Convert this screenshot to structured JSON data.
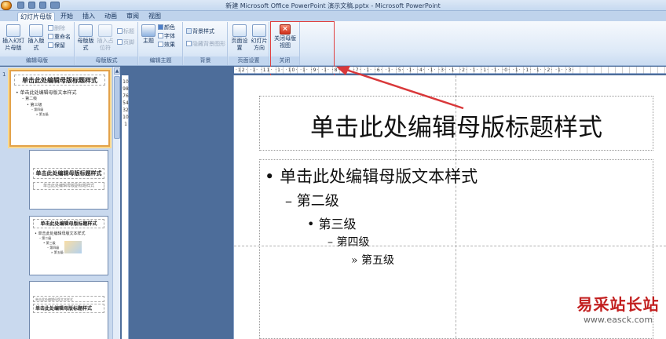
{
  "window": {
    "title": "新建 Microsoft Office PowerPoint 演示文稿.pptx - Microsoft PowerPoint"
  },
  "tabs": [
    {
      "label": "幻灯片母版",
      "active": true
    },
    {
      "label": "开始"
    },
    {
      "label": "插入"
    },
    {
      "label": "动画"
    },
    {
      "label": "审阅"
    },
    {
      "label": "视图"
    }
  ],
  "ribbon": {
    "groups": {
      "edit_master": {
        "label": "编辑母版",
        "insert_master": "插入幻灯片母版",
        "insert_layout": "插入版式",
        "delete": "删除",
        "rename": "重命名",
        "preserve": "保留"
      },
      "master_layout": {
        "label": "母版版式",
        "master_layout": "母版版式",
        "insert_placeholder": "插入占位符",
        "title": "标题",
        "footer": "页脚"
      },
      "edit_theme": {
        "label": "编辑主题",
        "themes": "主题",
        "colors": "颜色",
        "fonts": "字体",
        "effects": "效果"
      },
      "background": {
        "label": "背景",
        "bg_styles": "背景样式",
        "hide_bg": "隐藏背景图形"
      },
      "page_setup": {
        "label": "页面设置",
        "page_setup": "页面设置",
        "orientation": "幻灯片方向"
      },
      "close": {
        "label": "关闭",
        "close_master": "关闭母版视图"
      }
    }
  },
  "thumbnails": [
    {
      "num": "1",
      "title": "单击此处编辑母版标题样式",
      "lines": [
        "• 单击此处编辑母版文本样式",
        "– 第二级",
        "• 第三级",
        "– 第四级",
        "» 第五级"
      ]
    },
    {
      "title": "单击此处编辑母版标题样式",
      "sub": "单击此处编辑母版副标题样式"
    },
    {
      "title": "单击此处编辑母版标题样式",
      "lines": [
        "• 单击此处编辑母版文本样式",
        "– 第二级",
        "• 第三级",
        "– 第四级",
        "» 第五级"
      ]
    },
    {
      "title": "单击此处编辑母版标题样式",
      "sub": "单击此处编辑母版文本样式"
    }
  ],
  "ruler": {
    "horizontal": "·12· ·1· ·11· ·1· ·10· ·1· ·9· ·1· ·8· ·1· ·7· ·1· ·6· ·1· ·5· ·1· ·4· ·1· ·3· ·1· ·2· ·1· ·1· ·1· ·0· ·1· ·1· ·1· ·2· ·1· ·3·",
    "vertical": "1098765432101"
  },
  "slide": {
    "title": "单击此处编辑母版标题样式",
    "levels": [
      {
        "bullet": "•",
        "text": "单击此处编辑母版文本样式"
      },
      {
        "bullet": "–",
        "text": "第二级"
      },
      {
        "bullet": "•",
        "text": "第三级"
      },
      {
        "bullet": "–",
        "text": "第四级"
      },
      {
        "bullet": "»",
        "text": "第五级"
      }
    ]
  },
  "watermark": {
    "line1": "易采站长站",
    "line2": "www.easck.com"
  },
  "colors": {
    "highlight": "#e04040",
    "arrow": "#d9383a",
    "accent": "#e3a24a"
  }
}
